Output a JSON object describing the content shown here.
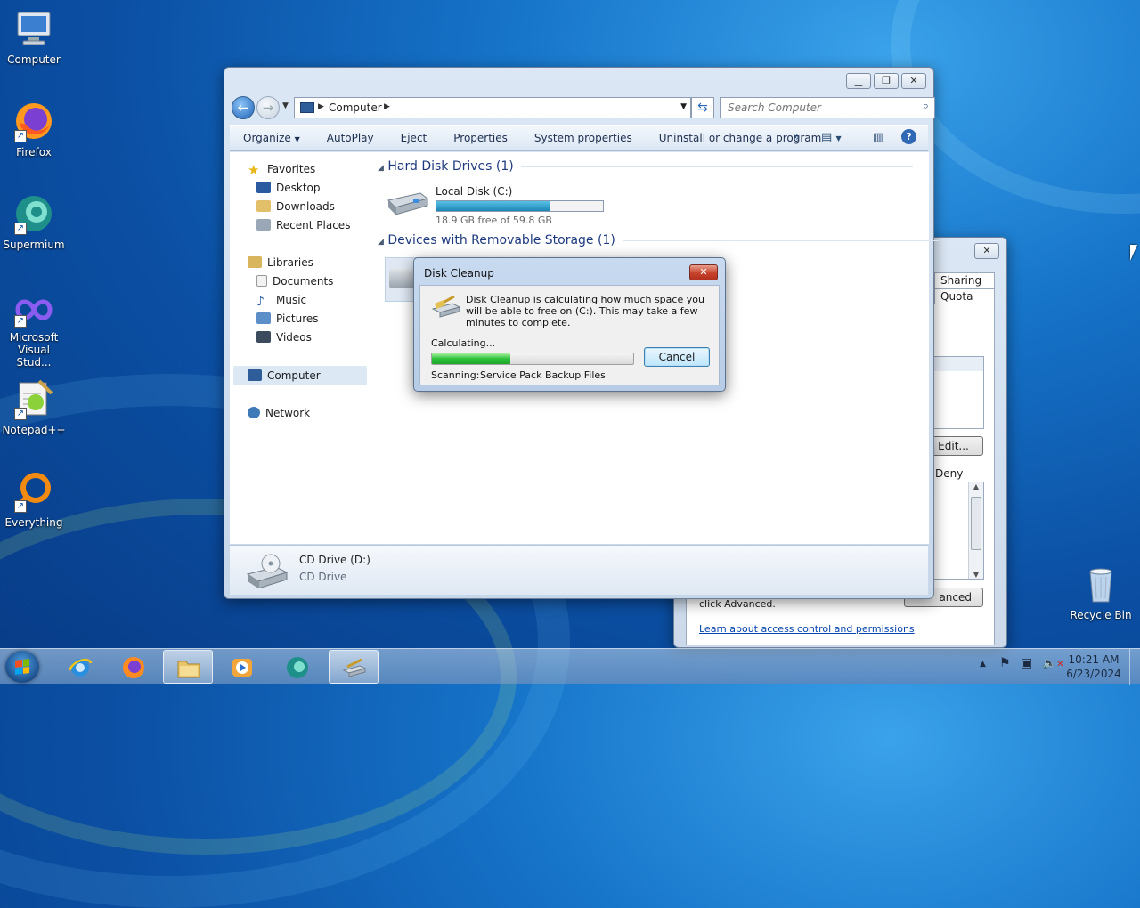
{
  "desktop": {
    "icons": [
      {
        "label": "Computer"
      },
      {
        "label": "Firefox"
      },
      {
        "label": "Supermium"
      },
      {
        "label": "Microsoft Visual Stud..."
      },
      {
        "label": "Notepad++"
      },
      {
        "label": "Everything"
      },
      {
        "label": "Recycle Bin"
      }
    ]
  },
  "explorer": {
    "address": {
      "crumb": "Computer"
    },
    "search": {
      "placeholder": "Search Computer"
    },
    "commands": [
      "Organize",
      "AutoPlay",
      "Eject",
      "Properties",
      "System properties",
      "Uninstall or change a program"
    ],
    "more_label": "»",
    "nav": {
      "favorites": "Favorites",
      "favorites_items": [
        "Desktop",
        "Downloads",
        "Recent Places"
      ],
      "libraries": "Libraries",
      "libraries_items": [
        "Documents",
        "Music",
        "Pictures",
        "Videos"
      ],
      "computer": "Computer",
      "network": "Network"
    },
    "groups": {
      "hdd": "Hard Disk Drives (1)",
      "removable": "Devices with Removable Storage (1)"
    },
    "local_disk": {
      "name": "Local Disk (C:)",
      "free_text": "18.9 GB free of 59.8 GB",
      "used_fraction": 0.684
    },
    "details": {
      "name": "CD Drive (D:)",
      "type": "CD Drive"
    }
  },
  "properties_window": {
    "tabs": [
      "Sharing",
      "Quota"
    ],
    "edit_button": "Edit...",
    "deny_label": "Deny",
    "advanced_text": "click Advanced.",
    "advanced_button": "anced",
    "link": "Learn about access control and permissions"
  },
  "disk_cleanup": {
    "title": "Disk Cleanup",
    "message": "Disk Cleanup is calculating how much space you will be able to free on  (C:). This may take a few minutes to complete.",
    "status": "Calculating...",
    "progress_fraction": 0.39,
    "cancel": "Cancel",
    "scanning_label": "Scanning:",
    "scanning_value": "Service Pack Backup Files"
  },
  "taskbar": {
    "clock_time": "10:21 AM",
    "clock_date": "6/23/2024"
  },
  "colors": {
    "accent": "#1e86b5",
    "progress_green": "#2cc03a",
    "close_red": "#c7432b"
  }
}
